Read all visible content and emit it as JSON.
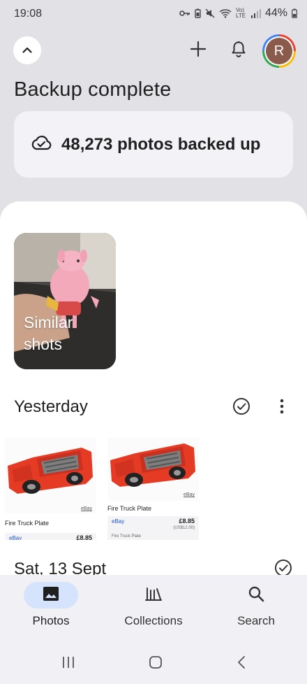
{
  "status_bar": {
    "time": "19:08",
    "battery_pct": "44%",
    "network_label": "Vo) LTE",
    "icons": [
      "vpn-key-icon",
      "battery-saver-icon",
      "mute-icon",
      "wifi-icon",
      "signal-icon",
      "battery-icon"
    ]
  },
  "header": {
    "collapse_icon": "chevron-up-icon",
    "add_icon": "plus-icon",
    "notifications_icon": "bell-icon",
    "avatar_initial": "R"
  },
  "backup": {
    "title": "Backup complete",
    "status_icon": "cloud-check-icon",
    "status_text": "48,273 photos backed up"
  },
  "memories": {
    "similar_shots_label": "Similar shots"
  },
  "sections": [
    {
      "title": "Yesterday",
      "photos": [
        {
          "ebay_tag": "eBay",
          "name": "Fire Truck Plate",
          "source": "eBay",
          "price": "£8.85"
        },
        {
          "ebay_tag": "eBay",
          "name": "Fire Truck Plate",
          "source": "eBay",
          "price": "£8.85",
          "price_sub": "(US$12.00)",
          "footer": "Fire Truck Plate"
        }
      ]
    },
    {
      "title": "Sat, 13 Sept"
    }
  ],
  "bottom_nav": [
    {
      "label": "Photos",
      "icon": "photo-icon",
      "active": true
    },
    {
      "label": "Collections",
      "icon": "collections-icon",
      "active": false
    },
    {
      "label": "Search",
      "icon": "search-icon",
      "active": false
    }
  ],
  "colors": {
    "background": "#e2e1e6",
    "active_pill": "#d5e3fc",
    "truck_red": "#e53b24"
  }
}
